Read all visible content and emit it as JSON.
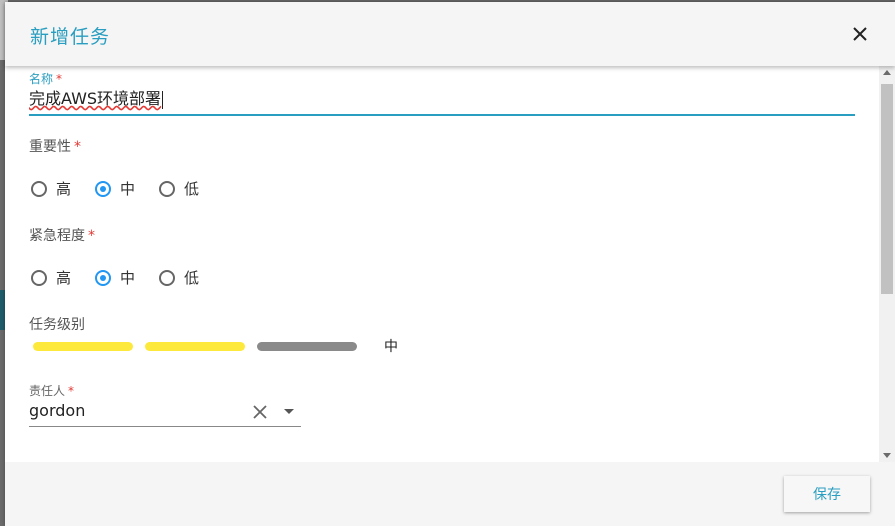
{
  "dialog": {
    "title": "新增任务",
    "close_icon": "close-icon"
  },
  "form": {
    "name": {
      "label": "名称",
      "required": "*",
      "value": "完成AWS环境部署"
    },
    "importance": {
      "label": "重要性",
      "required": "*",
      "options": [
        "高",
        "中",
        "低"
      ],
      "selected": "中"
    },
    "urgency": {
      "label": "紧急程度",
      "required": "*",
      "options": [
        "高",
        "中",
        "低"
      ],
      "selected": "中"
    },
    "level": {
      "label": "任务级别",
      "filled": 2,
      "total": 3,
      "value_text": "中",
      "colors": {
        "on": "#fde93b",
        "off": "#8a8a8a"
      }
    },
    "owner": {
      "label": "责任人",
      "required": "*",
      "value": "gordon"
    }
  },
  "footer": {
    "save_label": "保存"
  },
  "colors": {
    "accent": "#2a9ec0",
    "radio": "#2196f3",
    "required": "#e53935"
  }
}
